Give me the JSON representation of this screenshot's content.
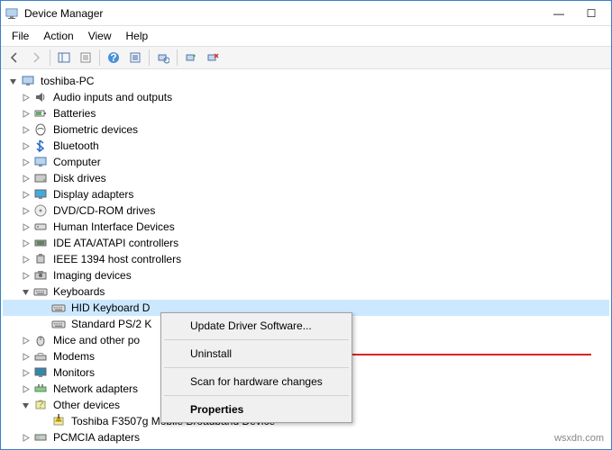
{
  "window": {
    "title": "Device Manager",
    "min_btn": "—",
    "max_btn": "☐",
    "close_btn": "✕"
  },
  "menu": {
    "file": "File",
    "action": "Action",
    "view": "View",
    "help": "Help"
  },
  "tree": {
    "root": "toshiba-PC",
    "nodes": [
      "Audio inputs and outputs",
      "Batteries",
      "Biometric devices",
      "Bluetooth",
      "Computer",
      "Disk drives",
      "Display adapters",
      "DVD/CD-ROM drives",
      "Human Interface Devices",
      "IDE ATA/ATAPI controllers",
      "IEEE 1394 host controllers",
      "Imaging devices",
      "Keyboards",
      "Mice and other po",
      "Modems",
      "Monitors",
      "Network adapters",
      "Other devices",
      "PCMCIA adapters"
    ],
    "keyboards_children": [
      "HID Keyboard D",
      "Standard PS/2 K"
    ],
    "other_children": [
      "Toshiba F3507g Mobile Broadband Device"
    ]
  },
  "context_menu": {
    "update": "Update Driver Software...",
    "uninstall": "Uninstall",
    "scan": "Scan for hardware changes",
    "properties": "Properties"
  },
  "watermark": "wsxdn.com"
}
